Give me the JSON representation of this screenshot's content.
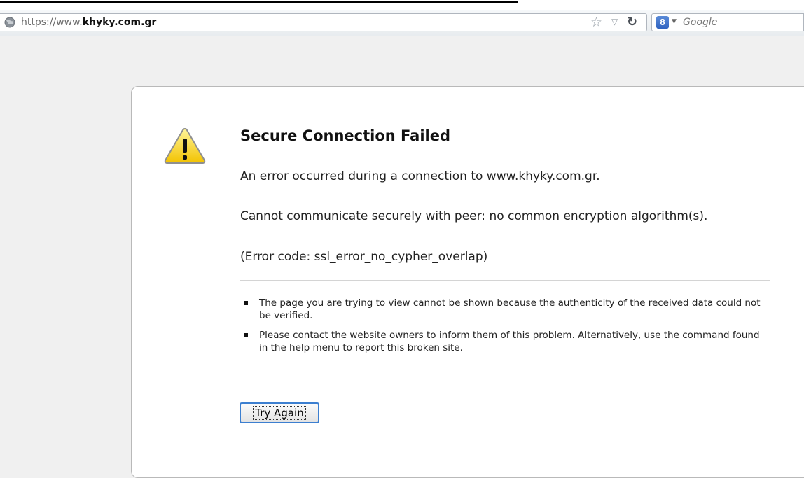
{
  "browser": {
    "url_prefix": "https://www.",
    "url_host": "khyky.com.gr",
    "search_engine_badge": "8",
    "search_placeholder": "Google",
    "icons": [
      "globe-icon",
      "bookmark-star-icon",
      "url-dropdown-icon",
      "reload-icon",
      "google-search-icon"
    ]
  },
  "error_page": {
    "title": "Secure Connection Failed",
    "message": "An error occurred during a connection to www.khyky.com.gr.",
    "detail": "Cannot communicate securely with peer: no common encryption algorithm(s).",
    "error_code": "(Error code: ssl_error_no_cypher_overlap)",
    "bullets": [
      "The page you are trying to view cannot be shown because the authenticity of the received data could not be verified.",
      "Please contact the website owners to inform them of this problem. Alternatively, use the command found in the help menu to report this broken site."
    ],
    "try_again_label": "Try Again",
    "warning_icon": "warning-triangle-icon",
    "accent_color": "#3c7fd0"
  }
}
